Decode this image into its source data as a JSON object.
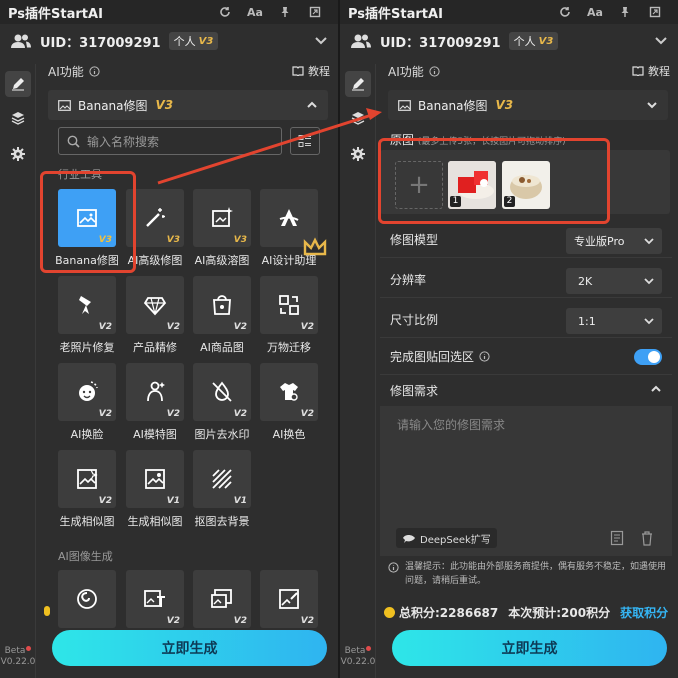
{
  "app": {
    "title": "Ps插件StartAI",
    "titlebar_aa": "Aa"
  },
  "user": {
    "uid": "UID：317009291",
    "plan": "个人",
    "plan_version": "V3"
  },
  "beta": {
    "label": "Beta",
    "version": "V0.22.0"
  },
  "ai_section": {
    "title": "AI功能",
    "tutorial": "教程"
  },
  "selector": {
    "name": "Banana修图",
    "version": "V3"
  },
  "search": {
    "placeholder": "输入名称搜索"
  },
  "groups": {
    "industry": "行业工具",
    "image_gen": "AI图像生成"
  },
  "tools": [
    {
      "label": "Banana修图",
      "version": "V3",
      "icon": "image-edit-icon",
      "selected": true
    },
    {
      "label": "AI高级修图",
      "version": "V3",
      "icon": "magic-wand-icon"
    },
    {
      "label": "AI高级溶图",
      "version": "V3",
      "icon": "image-sparkle-icon"
    },
    {
      "label": "AI设计助理",
      "version": "",
      "icon": "design-a-icon",
      "crown": true
    },
    {
      "label": "老照片修复",
      "version": "V2",
      "icon": "brush-restore-icon"
    },
    {
      "label": "产品精修",
      "version": "V2",
      "icon": "diamond-icon"
    },
    {
      "label": "AI商品图",
      "version": "V2",
      "icon": "shopping-bag-icon"
    },
    {
      "label": "万物迁移",
      "version": "V2",
      "icon": "transfer-icon"
    },
    {
      "label": "AI换脸",
      "version": "V2",
      "icon": "face-swap-icon"
    },
    {
      "label": "AI模特图",
      "version": "V2",
      "icon": "model-person-icon"
    },
    {
      "label": "图片去水印",
      "version": "V2",
      "icon": "watermark-remove-icon"
    },
    {
      "label": "AI换色",
      "version": "V2",
      "icon": "shirt-color-icon"
    },
    {
      "label": "生成相似图",
      "version": "V2",
      "icon": "similar-image-icon"
    },
    {
      "label": "生成相似图",
      "version": "V1",
      "icon": "similar-image-v1-icon"
    },
    {
      "label": "抠图去背景",
      "version": "V1",
      "icon": "cutout-icon"
    }
  ],
  "gen_tools": [
    {
      "version": "",
      "icon": "swirl-icon"
    },
    {
      "version": "V2",
      "icon": "text-image-icon"
    },
    {
      "version": "V2",
      "icon": "image-swap-icon"
    },
    {
      "version": "V2",
      "icon": "image-edit2-icon"
    }
  ],
  "generate_button": "立即生成",
  "right": {
    "source_label": "原图",
    "source_hint": "(最多上传5张，长按图片可拖动排序)",
    "thumbs": [
      "1",
      "2"
    ],
    "model_label": "修图模型",
    "model_value": "专业版Pro",
    "resolution_label": "分辨率",
    "resolution_value": "2K",
    "ratio_label": "尺寸比例",
    "ratio_value": "1:1",
    "paste_label": "完成图贴回选区",
    "paste_toggle": true,
    "req_label": "修图需求",
    "req_placeholder": "请输入您的修图需求",
    "deepseek": "DeepSeek扩写",
    "tip": "温馨提示：此功能由外部服务商提供，偶有服务不稳定，如遇使用问题，请稍后重试。",
    "total_points": "总积分:2286687",
    "estimate": "本次预计:200积分",
    "get_points": "获取积分"
  },
  "colors": {
    "accent": "#3ea0f5",
    "highlight": "#e2442f",
    "gold": "#e8b84a",
    "gradient_start": "#2ee6e8",
    "gradient_end": "#2fb4f0"
  }
}
